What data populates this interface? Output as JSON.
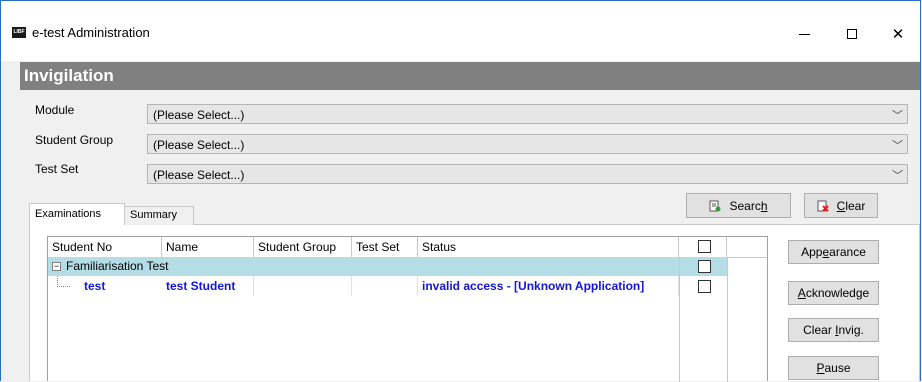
{
  "window": {
    "title": "e-test Administration",
    "app_icon_text": "LIBF",
    "minimize_label": "—",
    "close_label": "✕"
  },
  "header": {
    "title": "Invigilation"
  },
  "filters": [
    {
      "label": "Module",
      "value": "(Please Select...)"
    },
    {
      "label": "Student Group",
      "value": "(Please Select...)"
    },
    {
      "label": "Test Set",
      "value": "(Please Select...)"
    }
  ],
  "tabs": [
    {
      "label": "Examinations",
      "active": true
    },
    {
      "label": "Summary",
      "active": false
    }
  ],
  "buttons": {
    "search": {
      "label_pre": "Searc",
      "label_u": "h",
      "icon": "search-icon"
    },
    "clear": {
      "label_u": "C",
      "label_post": "lear",
      "icon": "clear-icon"
    },
    "appearance": {
      "label_pre": "App",
      "label_u": "e",
      "label_post": "arance"
    },
    "acknowledge": {
      "label_u": "A",
      "label_post": "cknowledge"
    },
    "clear_invig": {
      "label_pre": "Clear ",
      "label_u": "I",
      "label_post": "nvig."
    },
    "pause": {
      "label_u": "P",
      "label_post": "ause"
    }
  },
  "grid": {
    "columns": [
      "Student No",
      "Name",
      "Student Group",
      "Test Set",
      "Status"
    ],
    "group": {
      "label": "Familiarisation Test",
      "toggle": "−"
    },
    "rows": [
      {
        "student_no": "test",
        "name": "test Student",
        "student_group": "",
        "test_set": "",
        "status": "invalid access - [Unknown Application]"
      }
    ]
  },
  "colors": {
    "header_bg": "#808080",
    "group_row_bg": "#b4dde6",
    "row_text": "#1515d9",
    "window_border": "#2b6cc4"
  }
}
